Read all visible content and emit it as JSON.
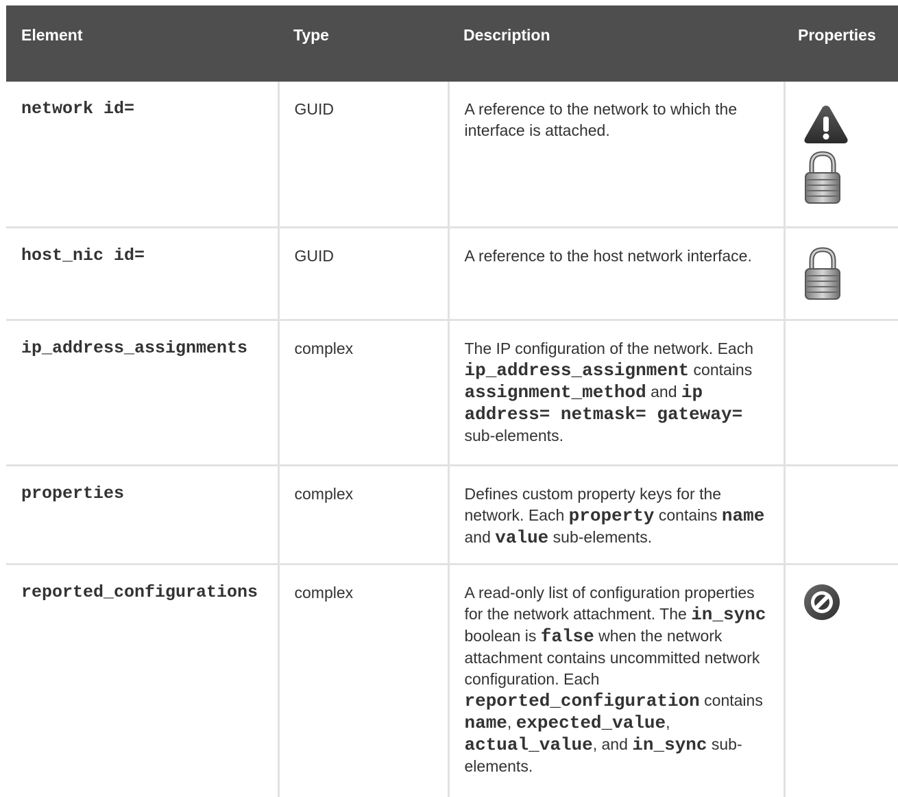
{
  "header": {
    "element": "Element",
    "type": "Type",
    "description": "Description",
    "properties": "Properties"
  },
  "rows": [
    {
      "element": "network id=",
      "type": "GUID",
      "description": "A reference to the network to which the interface is attached.",
      "properties": [
        "warning-icon",
        "lock-icon"
      ]
    },
    {
      "element": "host_nic id=",
      "type": "GUID",
      "description": "A reference to the host network interface.",
      "properties": [
        "lock-icon"
      ]
    },
    {
      "element": "ip_address_assignments",
      "type": "complex",
      "description_parts": [
        "The IP configuration of the network. Each ",
        "ip_address_assignment",
        " contains ",
        "assignment_method",
        " and ",
        "ip address= netmask= gateway=",
        " sub-elements."
      ],
      "properties": []
    },
    {
      "element": "properties",
      "type": "complex",
      "description_parts": [
        "Defines custom property keys for the network. Each ",
        "property",
        " contains ",
        "name",
        " and ",
        "value",
        " sub-elements."
      ],
      "properties": []
    },
    {
      "element": "reported_configurations",
      "type": "complex",
      "description_parts": [
        "A read-only list of configuration properties for the network attachment. The ",
        "in_sync",
        " boolean is ",
        "false",
        " when the network attachment contains uncommitted network configuration. Each ",
        "reported_configuration",
        " contains ",
        "name",
        ", ",
        "expected_value",
        ", ",
        "actual_value",
        ", and ",
        "in_sync",
        " sub-elements."
      ],
      "properties": [
        "read-only-icon"
      ]
    }
  ]
}
